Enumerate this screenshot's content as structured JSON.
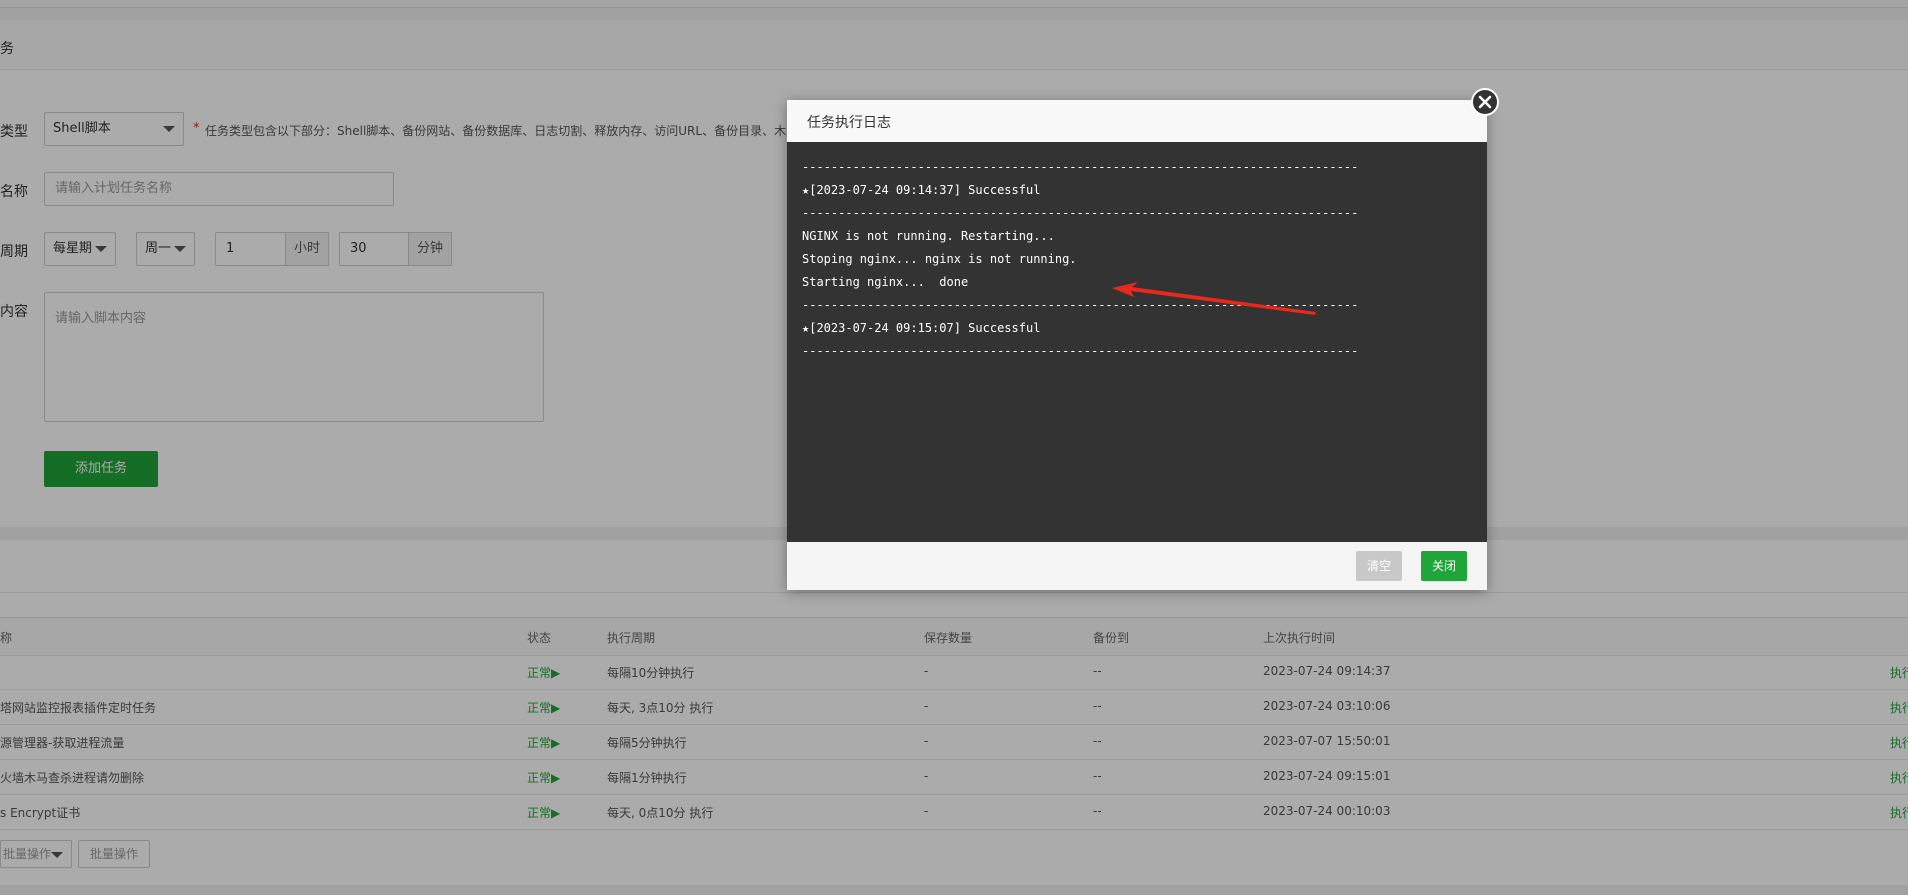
{
  "form": {
    "title_fragment": "务",
    "type_label": "类型",
    "type_value": "Shell脚本",
    "type_hint": "任务类型包含以下部分：Shell脚本、备份网站、备份数据库、日志切割、释放内存、访问URL、备份目录、木马",
    "name_label": "名称",
    "name_placeholder": "请输入计划任务名称",
    "cycle_label": "周期",
    "cycle_value": "每星期",
    "weekday_value": "周一",
    "hour_value": "1",
    "hour_unit": "小时",
    "minute_value": "30",
    "minute_unit": "分钟",
    "script_label": "内容",
    "script_placeholder": "请输入脚本内容",
    "add_button": "添加任务",
    "required_mark": "*"
  },
  "table": {
    "headers": {
      "name": "称",
      "status": "状态",
      "cycle": "执行周期",
      "keep": "保存数量",
      "backup": "备份到",
      "last_run": "上次执行时间"
    },
    "rows": [
      {
        "name": "",
        "status": "正常▶",
        "cycle": "每隔10分钟执行",
        "keep": "-",
        "backup": "--",
        "last_run": "2023-07-24 09:14:37",
        "action": "执行"
      },
      {
        "name": "塔网站监控报表插件定时任务",
        "status": "正常▶",
        "cycle": "每天, 3点10分 执行",
        "keep": "-",
        "backup": "--",
        "last_run": "2023-07-24 03:10:06",
        "action": "执行"
      },
      {
        "name": "源管理器-获取进程流量",
        "status": "正常▶",
        "cycle": "每隔5分钟执行",
        "keep": "-",
        "backup": "--",
        "last_run": "2023-07-07 15:50:01",
        "action": "执行"
      },
      {
        "name": "火墙木马查杀进程请勿删除",
        "status": "正常▶",
        "cycle": "每隔1分钟执行",
        "keep": "-",
        "backup": "--",
        "last_run": "2023-07-24 09:15:01",
        "action": "执行"
      },
      {
        "name": "s Encrypt证书",
        "status": "正常▶",
        "cycle": "每天, 0点10分 执行",
        "keep": "-",
        "backup": "--",
        "last_run": "2023-07-24 00:10:03",
        "action": "执行"
      }
    ],
    "batch_select": "批量操作",
    "batch_button": "批量操作"
  },
  "modal": {
    "title": "任务执行日志",
    "log_lines": [
      "-----------------------------------------------------------------------------",
      "★[2023-07-24 09:14:37] Successful",
      "-----------------------------------------------------------------------------",
      "NGINX is not running. Restarting...",
      "Stoping nginx... nginx is not running.",
      "Starting nginx...  done",
      "-----------------------------------------------------------------------------",
      "★[2023-07-24 09:15:07] Successful",
      "-----------------------------------------------------------------------------"
    ],
    "clear_button": "清空",
    "close_button": "关闭",
    "close_icon": "✕"
  },
  "colors": {
    "accent": "#20a53a",
    "log_bg": "#333333",
    "annotation_arrow": "#e8291c"
  }
}
